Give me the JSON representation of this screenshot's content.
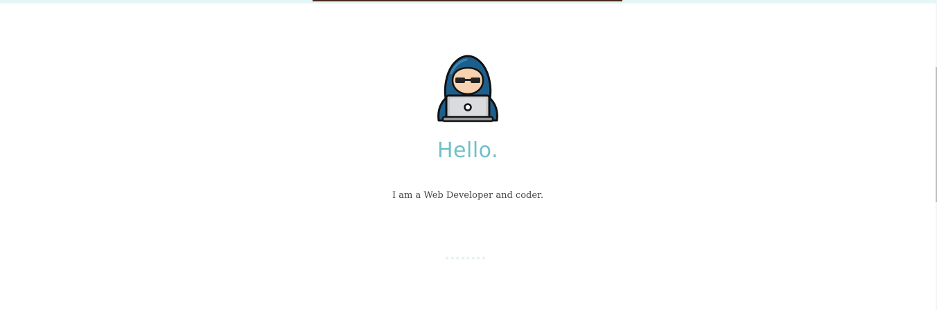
{
  "hero": {
    "avatar_icon": "hacker-with-laptop-icon",
    "greeting": "Hello.",
    "tagline": "I am a Web Developer and coder."
  },
  "colors": {
    "accent": "#6fc0c8",
    "top_strip": "#e4f6f5",
    "top_bar": "#4a2a1a",
    "text": "#444444"
  },
  "loader": {
    "dot_count": 8
  }
}
